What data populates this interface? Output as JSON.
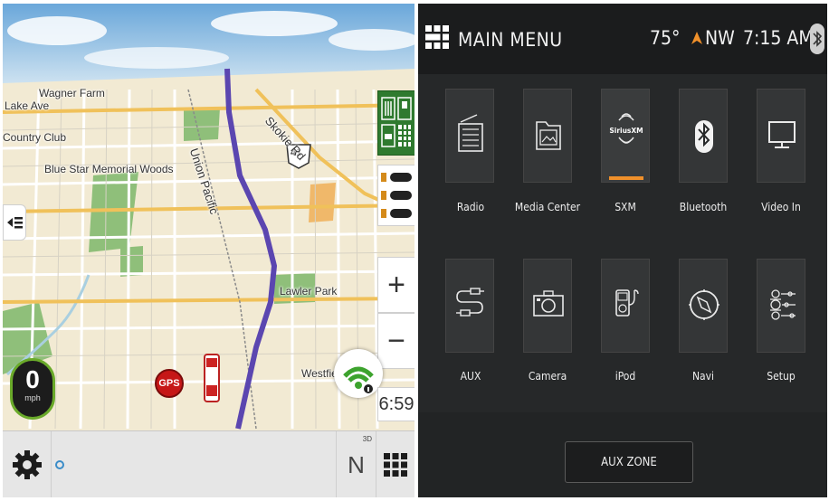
{
  "map": {
    "labels": {
      "wagner_farm": "Wagner Farm",
      "lake_ave": "Lake Ave",
      "country_club": "Country Club",
      "blue_star": "Blue Star Memorial Woods",
      "union_pacific": "Union Pacific",
      "route_41": "41",
      "skokie_rd": "Skokie Rd",
      "lawler_park": "Lawler Park",
      "westfield": "Westfield"
    },
    "speed": {
      "value": "0",
      "unit": "mph"
    },
    "gps_badge": "GPS",
    "clock": "6:59",
    "zoom_in": "+",
    "zoom_out": "−",
    "compass": "N",
    "compass_mode": "3D",
    "colors": {
      "route": "#5b46b0",
      "park": "#8fbf7a",
      "road": "#f0c15a",
      "water": "#a9cfe0"
    }
  },
  "menu": {
    "title": "MAIN MENU",
    "temperature": "75°",
    "direction": "NW",
    "time": "7:15 AM",
    "accent_color": "#f0902a",
    "tiles": [
      {
        "id": "radio",
        "label": "Radio",
        "icon": "radio-icon"
      },
      {
        "id": "media",
        "label": "Media Center",
        "icon": "media-folder-icon"
      },
      {
        "id": "sxm",
        "label": "SXM",
        "icon": "siriusxm-icon",
        "logo_text": "SiriusXM",
        "active": true
      },
      {
        "id": "bluetooth",
        "label": "Bluetooth",
        "icon": "bluetooth-icon"
      },
      {
        "id": "video",
        "label": "Video In",
        "icon": "monitor-icon"
      },
      {
        "id": "aux",
        "label": "AUX",
        "icon": "aux-cable-icon"
      },
      {
        "id": "camera",
        "label": "Camera",
        "icon": "camera-icon"
      },
      {
        "id": "ipod",
        "label": "iPod",
        "icon": "ipod-icon"
      },
      {
        "id": "navi",
        "label": "Navi",
        "icon": "compass-icon"
      },
      {
        "id": "setup",
        "label": "Setup",
        "icon": "settings-sliders-icon"
      }
    ],
    "aux_zone": "AUX ZONE"
  }
}
